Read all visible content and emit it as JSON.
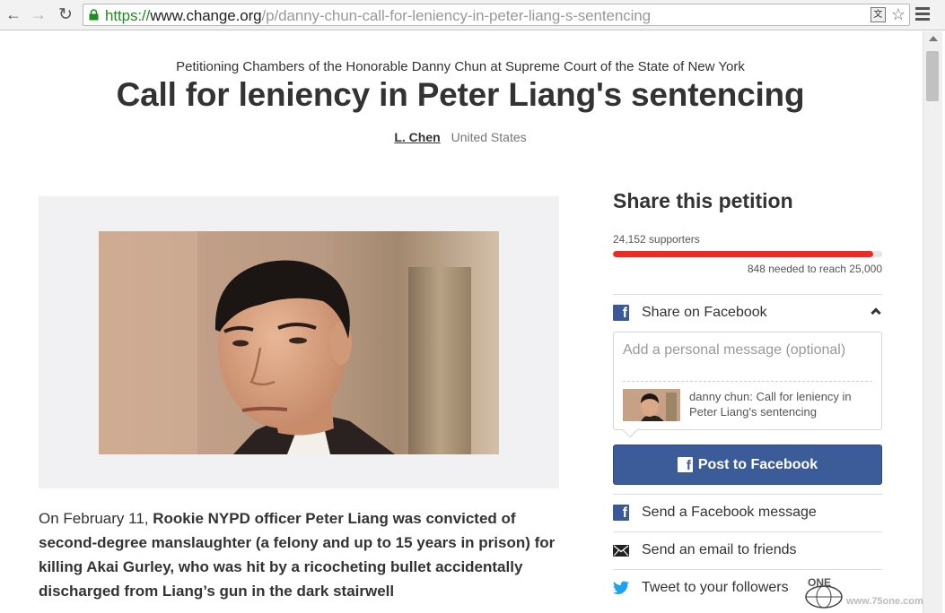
{
  "browser": {
    "url_scheme": "https://",
    "url_host": "www.change.org",
    "url_path": "/p/danny-chun-call-for-leniency-in-peter-liang-s-sentencing",
    "translate_icon": "translate-icon",
    "star_icon": "bookmark-star-icon"
  },
  "petition": {
    "petitioning": "Petitioning Chambers of the Honorable Danny Chun at Supreme Court of the State of New York",
    "title": "Call for leniency in Peter Liang's sentencing",
    "author": "L. Chen",
    "location": "United States",
    "description": {
      "lead": "On February 11, ",
      "bold": "Rookie NYPD officer Peter Liang was convicted of second-degree manslaughter (a felony and up to 15 years in prison) for killing Akai Gurley, who was hit by a ricocheting bullet accidentally discharged from Liang’s gun in the dark stairwell"
    }
  },
  "sidebar": {
    "share_title": "Share this petition",
    "supporters": "24,152 supporters",
    "progress_fraction": 0.966,
    "needed": "848 needed to reach 25,000",
    "facebook_share_label": "Share on Facebook",
    "compose_placeholder": "Add a personal message (optional)",
    "preview_text": "danny chun: Call for leniency in Peter Liang's sentencing",
    "post_button": "Post to Facebook",
    "fb_message_label": "Send a Facebook message",
    "email_label": "Send an email to friends",
    "tweet_label": "Tweet to your followers"
  },
  "colors": {
    "progress": "#ec2c22",
    "facebook": "#3b5998",
    "url_scheme": "#1e8c1e"
  },
  "watermark": {
    "logo": "ONE",
    "site": "www.75one.com"
  }
}
